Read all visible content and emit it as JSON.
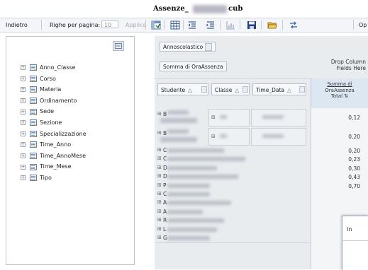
{
  "title": {
    "prefix": "Assenze_",
    "suffix": "cub"
  },
  "toolbar": {
    "back_label": "Indietro",
    "rows_label": "Righe per pagina:",
    "rows_value": "10",
    "apply_label": "Applica",
    "op_label": "Op"
  },
  "tree": {
    "items": [
      {
        "label": "Anno_Classe"
      },
      {
        "label": "Corso"
      },
      {
        "label": "Materia"
      },
      {
        "label": "Ordinamento"
      },
      {
        "label": "Sede"
      },
      {
        "label": "Sezione"
      },
      {
        "label": "Specializzazione"
      },
      {
        "label": "Time_Anno"
      },
      {
        "label": "Time_AnnoMese"
      },
      {
        "label": "Time_Mese"
      },
      {
        "label": "Tipo"
      }
    ],
    "expander_glyph": "+"
  },
  "pivot": {
    "filter_field": "Annoscolastico",
    "data_field": "Somma di OraAssenza",
    "drop_column_line1": "Drop Column",
    "drop_column_line2": "Fields Here",
    "row_headers": [
      {
        "label": "Studente",
        "sort": "△"
      },
      {
        "label": "Classe",
        "sort": "△"
      },
      {
        "label": "Time_Data",
        "sort": "△"
      }
    ],
    "measure_header_line1": "Somma di",
    "measure_header_line2": "OraAssenza",
    "measure_header_line3": "Total",
    "measure_header_sort": "⇅",
    "rows": [
      {
        "initial": "B",
        "value": "0,12"
      },
      {
        "initial": "B",
        "value": "0,20"
      },
      {
        "initial": "C",
        "value": "0,20"
      },
      {
        "initial": "C",
        "value": "0,23"
      },
      {
        "initial": "D",
        "value": "0,30"
      },
      {
        "initial": "D",
        "value": "0,43"
      },
      {
        "initial": "P",
        "value": "0,70"
      },
      {
        "initial": "C",
        "value": ""
      },
      {
        "initial": "A",
        "value": ""
      },
      {
        "initial": "A",
        "value": ""
      },
      {
        "initial": "R",
        "value": ""
      },
      {
        "initial": "L",
        "value": ""
      },
      {
        "initial": "G",
        "value": ""
      }
    ]
  },
  "popup": {
    "title": "In"
  },
  "colors": {
    "measure_header_bg": "#dde7f2",
    "pivot_bg": "#e9ecef",
    "toolbar_bg": "#f3f5f8"
  }
}
